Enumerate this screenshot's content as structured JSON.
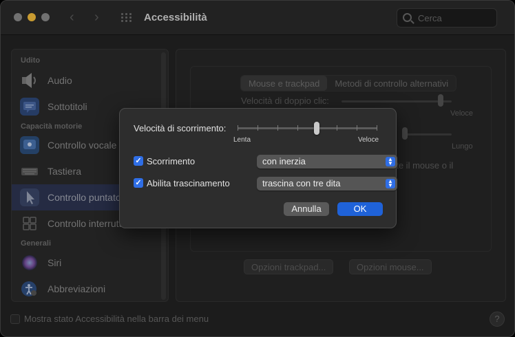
{
  "window": {
    "title": "Accessibilità"
  },
  "search": {
    "placeholder": "Cerca"
  },
  "sidebar": {
    "sections": [
      "Udito",
      "Capacità motorie",
      "Generali"
    ],
    "items": [
      {
        "label": "Audio",
        "icon": "speaker-icon"
      },
      {
        "label": "Sottotitoli",
        "icon": "captions-icon"
      },
      {
        "label": "Controllo vocale",
        "icon": "voice-control-icon"
      },
      {
        "label": "Tastiera",
        "icon": "keyboard-icon"
      },
      {
        "label": "Controllo puntatore",
        "icon": "pointer-icon",
        "selected": true
      },
      {
        "label": "Controllo interruttori",
        "icon": "switch-control-icon"
      },
      {
        "label": "Siri",
        "icon": "siri-icon"
      },
      {
        "label": "Abbreviazioni",
        "icon": "shortcut-icon"
      }
    ]
  },
  "panel": {
    "tabs": [
      "Mouse e trackpad",
      "Metodi di controllo alternativi"
    ],
    "double_click_label": "Velocità di doppio clic:",
    "double_click_max": "Veloce",
    "delay_max": "Lungo",
    "partial_text": "nte il mouse o il",
    "trackpad_options": "Opzioni trackpad...",
    "mouse_options": "Opzioni mouse..."
  },
  "footer": {
    "menu_bar_label": "Mostra stato Accessibilità nella barra dei menu"
  },
  "dialog": {
    "scroll_speed_label": "Velocità di scorrimento:",
    "scroll_speed_min": "Lenta",
    "scroll_speed_max": "Veloce",
    "scroll_speed_level": 0.57,
    "scrolling": {
      "label": "Scorrimento",
      "checked": true,
      "value": "con inerzia"
    },
    "dragging": {
      "label": "Abilita trascinamento",
      "checked": true,
      "value": "trascina con tre dita"
    },
    "cancel_label": "Annulla",
    "ok_label": "OK"
  },
  "colors": {
    "accent": "#2f6ee6",
    "ok_button": "#1f62d8",
    "minimize": "#f4bd3c"
  }
}
